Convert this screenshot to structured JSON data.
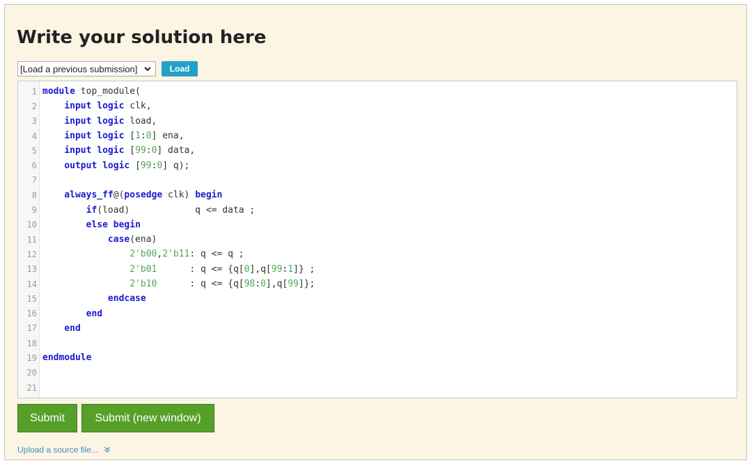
{
  "heading": "Write your solution here",
  "load_bar": {
    "select_value": "[Load a previous submission]",
    "load_button": "Load"
  },
  "editor": {
    "lines": [
      [
        {
          "t": "module",
          "c": "kw"
        },
        {
          "t": " top_module(",
          "c": ""
        }
      ],
      [
        {
          "t": "    ",
          "c": ""
        },
        {
          "t": "input",
          "c": "kw"
        },
        {
          "t": " ",
          "c": ""
        },
        {
          "t": "logic",
          "c": "kw"
        },
        {
          "t": " clk,",
          "c": ""
        }
      ],
      [
        {
          "t": "    ",
          "c": ""
        },
        {
          "t": "input",
          "c": "kw"
        },
        {
          "t": " ",
          "c": ""
        },
        {
          "t": "logic",
          "c": "kw"
        },
        {
          "t": " load,",
          "c": ""
        }
      ],
      [
        {
          "t": "    ",
          "c": ""
        },
        {
          "t": "input",
          "c": "kw"
        },
        {
          "t": " ",
          "c": ""
        },
        {
          "t": "logic",
          "c": "kw"
        },
        {
          "t": " [",
          "c": ""
        },
        {
          "t": "1",
          "c": "num"
        },
        {
          "t": ":",
          "c": ""
        },
        {
          "t": "0",
          "c": "num"
        },
        {
          "t": "] ena,",
          "c": ""
        }
      ],
      [
        {
          "t": "    ",
          "c": ""
        },
        {
          "t": "input",
          "c": "kw"
        },
        {
          "t": " ",
          "c": ""
        },
        {
          "t": "logic",
          "c": "kw"
        },
        {
          "t": " [",
          "c": ""
        },
        {
          "t": "99",
          "c": "num"
        },
        {
          "t": ":",
          "c": ""
        },
        {
          "t": "0",
          "c": "num"
        },
        {
          "t": "] data,",
          "c": ""
        }
      ],
      [
        {
          "t": "    ",
          "c": ""
        },
        {
          "t": "output",
          "c": "kw"
        },
        {
          "t": " ",
          "c": ""
        },
        {
          "t": "logic",
          "c": "kw"
        },
        {
          "t": " [",
          "c": ""
        },
        {
          "t": "99",
          "c": "num"
        },
        {
          "t": ":",
          "c": ""
        },
        {
          "t": "0",
          "c": "num"
        },
        {
          "t": "] q);",
          "c": ""
        }
      ],
      [],
      [
        {
          "t": "    ",
          "c": ""
        },
        {
          "t": "always_ff",
          "c": "kw"
        },
        {
          "t": "@(",
          "c": ""
        },
        {
          "t": "posedge",
          "c": "kw"
        },
        {
          "t": " clk) ",
          "c": ""
        },
        {
          "t": "begin",
          "c": "kw"
        }
      ],
      [
        {
          "t": "        ",
          "c": ""
        },
        {
          "t": "if",
          "c": "kw"
        },
        {
          "t": "(load)            q <= data ;",
          "c": ""
        }
      ],
      [
        {
          "t": "        ",
          "c": ""
        },
        {
          "t": "else",
          "c": "kw"
        },
        {
          "t": " ",
          "c": ""
        },
        {
          "t": "begin",
          "c": "kw"
        }
      ],
      [
        {
          "t": "            ",
          "c": ""
        },
        {
          "t": "case",
          "c": "kw"
        },
        {
          "t": "(ena)",
          "c": ""
        }
      ],
      [
        {
          "t": "                ",
          "c": ""
        },
        {
          "t": "2'b00",
          "c": "num"
        },
        {
          "t": ",",
          "c": ""
        },
        {
          "t": "2'b11",
          "c": "num"
        },
        {
          "t": ": q <= q ;",
          "c": ""
        }
      ],
      [
        {
          "t": "                ",
          "c": ""
        },
        {
          "t": "2'b01",
          "c": "num"
        },
        {
          "t": "      : q <= {q[",
          "c": ""
        },
        {
          "t": "0",
          "c": "num"
        },
        {
          "t": "],q[",
          "c": ""
        },
        {
          "t": "99",
          "c": "num"
        },
        {
          "t": ":",
          "c": ""
        },
        {
          "t": "1",
          "c": "num"
        },
        {
          "t": "]} ;",
          "c": ""
        }
      ],
      [
        {
          "t": "                ",
          "c": ""
        },
        {
          "t": "2'b10",
          "c": "num"
        },
        {
          "t": "      : q <= {q[",
          "c": ""
        },
        {
          "t": "98",
          "c": "num"
        },
        {
          "t": ":",
          "c": ""
        },
        {
          "t": "0",
          "c": "num"
        },
        {
          "t": "],q[",
          "c": ""
        },
        {
          "t": "99",
          "c": "num"
        },
        {
          "t": "]};",
          "c": ""
        }
      ],
      [
        {
          "t": "            ",
          "c": ""
        },
        {
          "t": "endcase",
          "c": "kw"
        }
      ],
      [
        {
          "t": "        ",
          "c": ""
        },
        {
          "t": "end",
          "c": "kw"
        }
      ],
      [
        {
          "t": "    ",
          "c": ""
        },
        {
          "t": "end",
          "c": "kw"
        }
      ],
      [],
      [
        {
          "t": "endmodule",
          "c": "kw"
        }
      ],
      [],
      []
    ]
  },
  "buttons": {
    "submit": "Submit",
    "submit_new_window": "Submit (new window)"
  },
  "upload_link": "Upload a source file...",
  "colors": {
    "panel_bg": "#fdf5e4",
    "keyword": "#1a1ad0",
    "number": "#4fa84f",
    "load_button": "#22a0c8",
    "submit_button": "#56a02a",
    "link": "#3a8fc0"
  },
  "icons": {
    "select_arrow": "chevron-down-icon",
    "upload_toggle": "double-chevron-down-icon"
  }
}
